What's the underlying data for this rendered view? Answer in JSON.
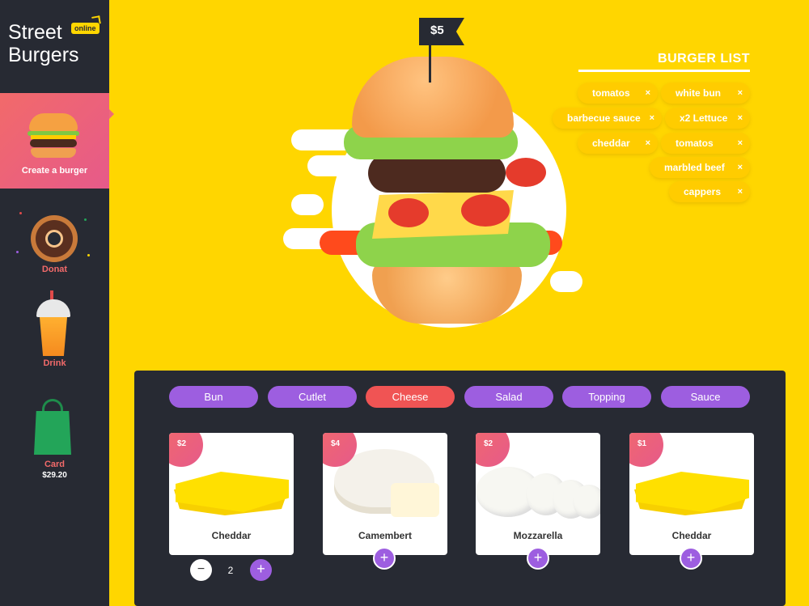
{
  "app": {
    "logo_line1": "Street",
    "logo_line2": "Burgers",
    "logo_badge": "online"
  },
  "sidebar": {
    "items": [
      {
        "label": "Create a burger",
        "icon": "burger-icon",
        "active": true
      },
      {
        "label": "Donat",
        "icon": "donut-icon"
      },
      {
        "label": "Drink",
        "icon": "drink-icon"
      },
      {
        "label": "Card",
        "icon": "shopping-bag-icon",
        "total": "$29.20"
      }
    ]
  },
  "hero": {
    "price_flag": "$5"
  },
  "burger_list": {
    "title": "BURGER LIST",
    "items": [
      {
        "label": "tomatos"
      },
      {
        "label": "white bun"
      },
      {
        "label": "barbecue sauce"
      },
      {
        "label": "x2 Lettuce"
      },
      {
        "label": "cheddar"
      },
      {
        "label": "tomatos"
      },
      {
        "label": "marbled beef"
      },
      {
        "label": "cappers"
      }
    ],
    "remove_glyph": "×"
  },
  "categories": {
    "tabs": [
      {
        "label": "Bun"
      },
      {
        "label": "Cutlet"
      },
      {
        "label": "Cheese",
        "active": true
      },
      {
        "label": "Salad"
      },
      {
        "label": "Topping"
      },
      {
        "label": "Sauce"
      }
    ]
  },
  "products": [
    {
      "name": "Cheddar",
      "price": "$2",
      "quantity": "2"
    },
    {
      "name": "Camembert",
      "price": "$4"
    },
    {
      "name": "Mozzarella",
      "price": "$2"
    },
    {
      "name": "Cheddar",
      "price": "$1"
    }
  ],
  "controls": {
    "minus": "−",
    "plus": "+"
  },
  "colors": {
    "background": "#ffd600",
    "sidebar": "#272a33",
    "accent_purple": "#9d5ee0",
    "accent_red": "#f05454"
  }
}
